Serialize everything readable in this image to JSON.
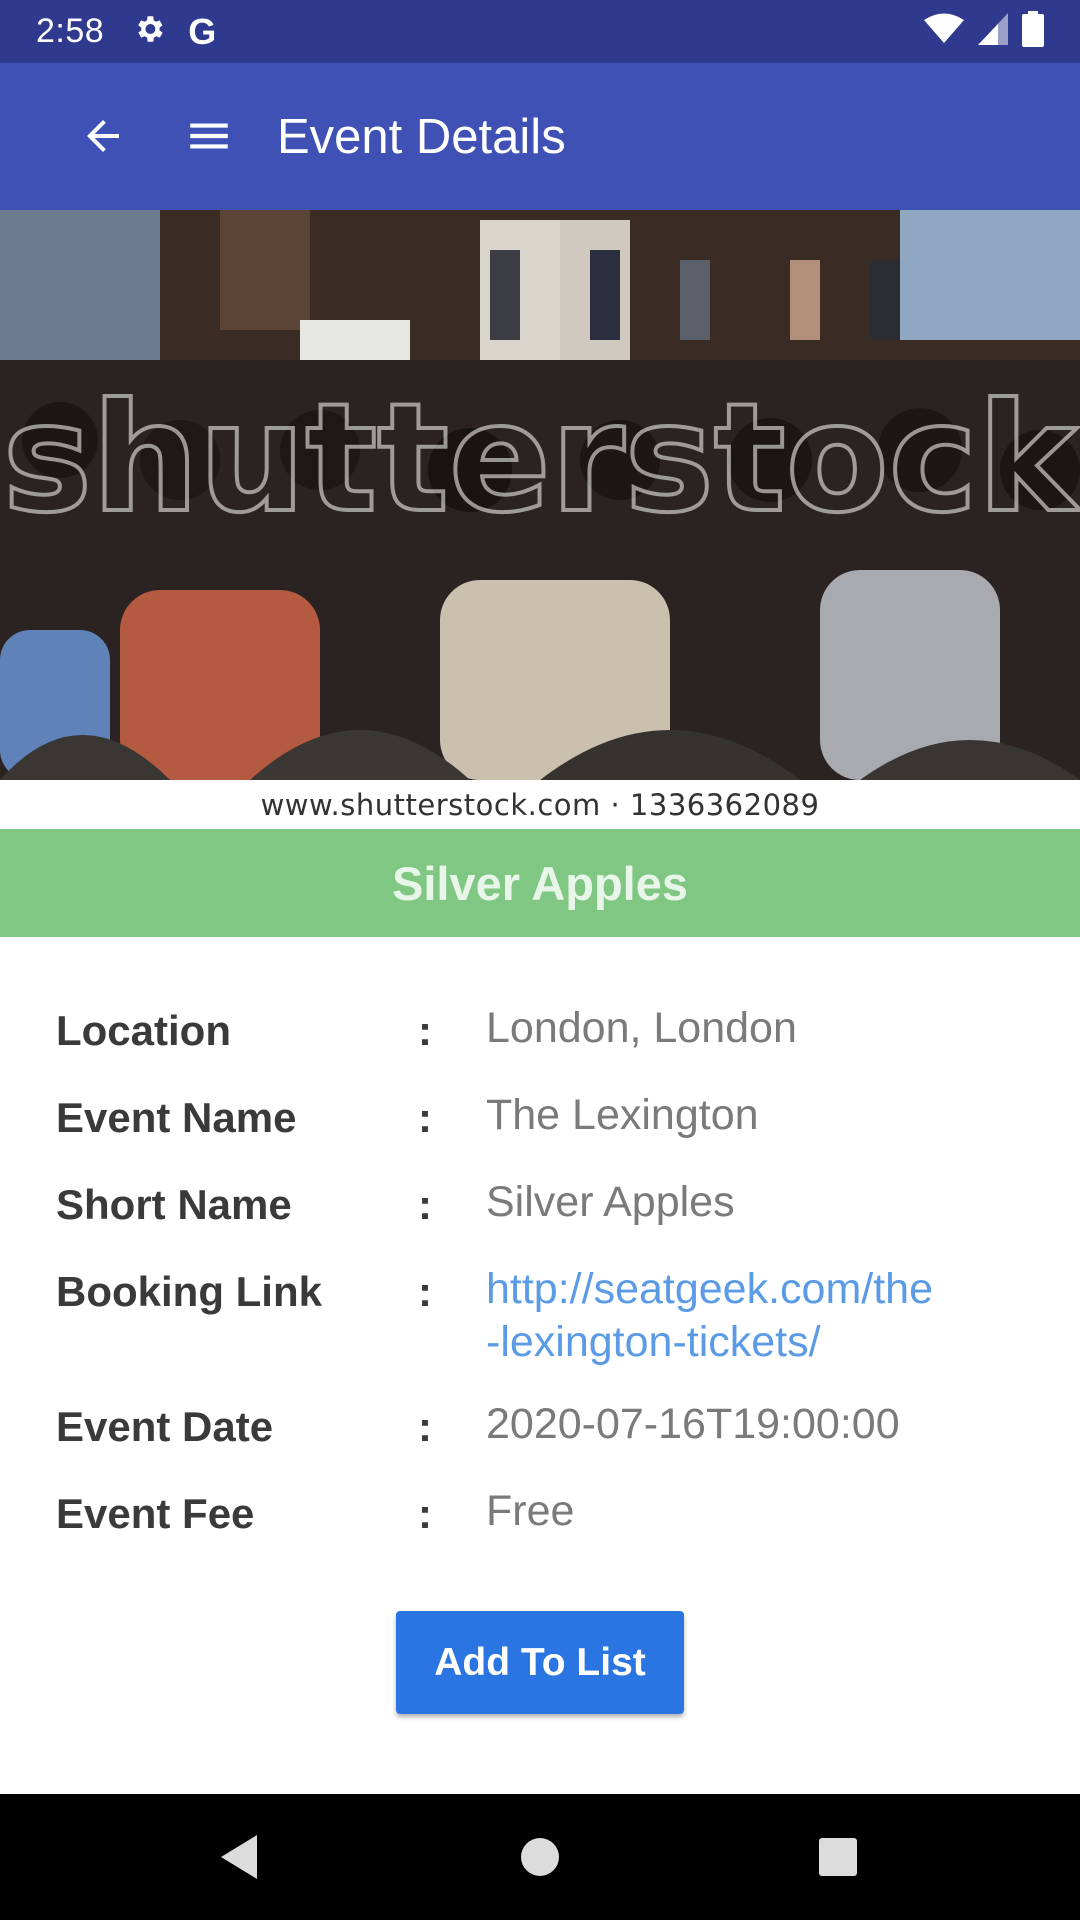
{
  "status_bar": {
    "time": "2:58",
    "icons": [
      "gear-icon",
      "google-g-icon",
      "wifi-icon",
      "signal-icon",
      "battery-icon"
    ],
    "google_glyph": "G"
  },
  "app_bar": {
    "title": "Event Details",
    "color": "#3f51b5"
  },
  "hero": {
    "credit": "www.shutterstock.com · 1336362089",
    "watermark": "shutterstock"
  },
  "event": {
    "banner_title": "Silver Apples",
    "banner_color": "#81c784",
    "fields": [
      {
        "label": "Location",
        "colon": ":",
        "value": "London, London"
      },
      {
        "label": "Event Name",
        "colon": ":",
        "value": "The Lexington"
      },
      {
        "label": "Short Name",
        "colon": ":",
        "value": "Silver Apples"
      },
      {
        "label": "Booking Link",
        "colon": ":",
        "value_line1": "http://seatgeek.com/the",
        "value_line2": "-lexington-tickets/"
      },
      {
        "label": "Event Date",
        "colon": ":",
        "value": "2020-07-16T19:00:00"
      },
      {
        "label": "Event Fee",
        "colon": ":",
        "value": "Free"
      }
    ]
  },
  "actions": {
    "add_label": "Add To List",
    "color": "#2a75e2"
  }
}
